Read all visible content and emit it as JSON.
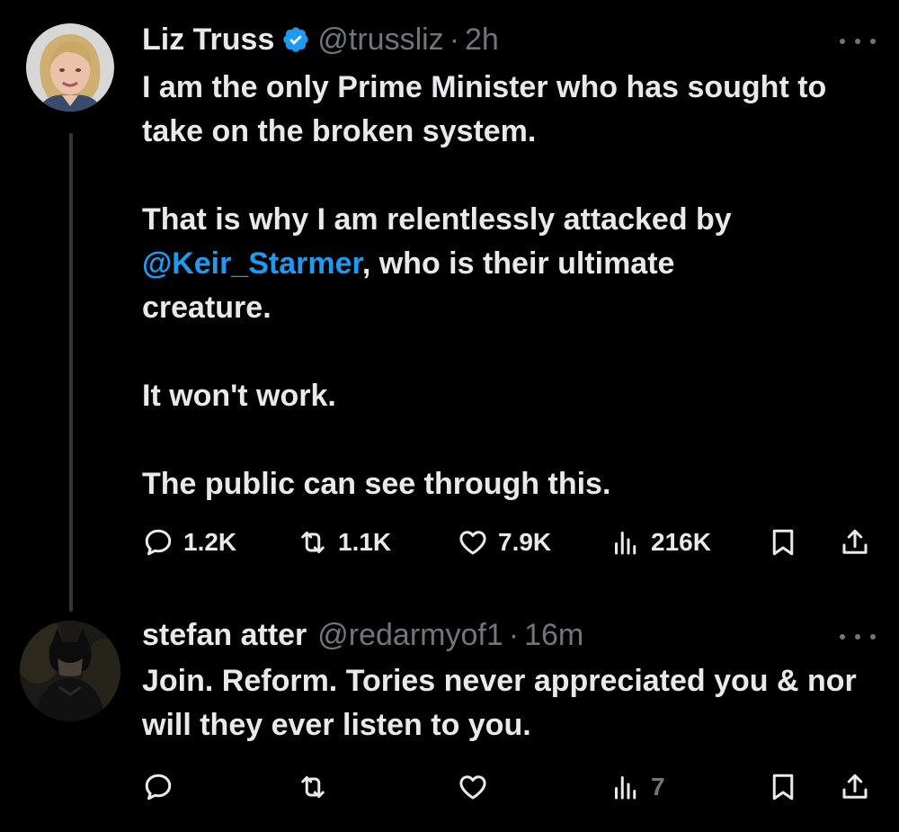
{
  "tweets": [
    {
      "name": "Liz Truss",
      "verified": true,
      "handle": "@trussliz",
      "time": "2h",
      "body": {
        "p1": "I am the only Prime Minister who has sought to take on the broken system.",
        "p2_before": "That is why I am relentlessly attacked by ",
        "p2_mention": "@Keir_Starmer",
        "p2_after": ", who is their ultimate creature.",
        "p3": "It won't work.",
        "p4": "The public can see through this."
      },
      "stats": {
        "replies": "1.2K",
        "reposts": "1.1K",
        "likes": "7.9K",
        "views": "216K"
      }
    },
    {
      "name": "stefan atter",
      "handle": "@redarmyof1",
      "time": "16m",
      "body": {
        "p1": "Join. Reform. Tories never appreciated you & nor will they ever listen to you."
      },
      "stats": {
        "views": "7"
      }
    }
  ],
  "separator": "·",
  "icons": {
    "more": "more-horizontal-icon",
    "reply": "reply-icon",
    "repost": "repost-icon",
    "like": "heart-icon",
    "views": "analytics-icon",
    "bookmark": "bookmark-icon",
    "share": "share-icon",
    "verified": "verified-badge-icon"
  },
  "colors": {
    "background": "#000000",
    "text": "#e7e9ea",
    "muted": "#71767b",
    "accent": "#1d9bf0"
  }
}
